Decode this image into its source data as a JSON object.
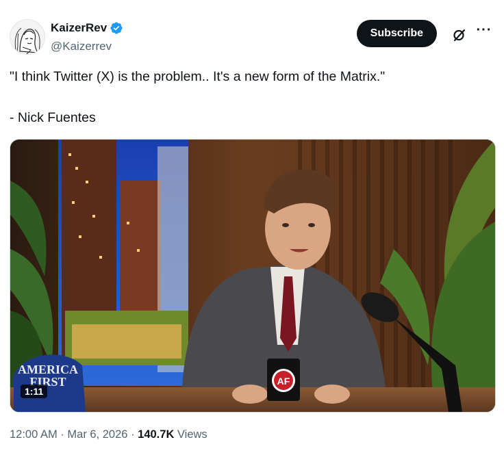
{
  "author": {
    "display_name": "KaizerRev",
    "handle": "@Kaizerrev",
    "verified": true,
    "avatar_icon": "sketch-portrait-avatar"
  },
  "actions": {
    "subscribe_label": "Subscribe",
    "grok_icon": "grok-icon",
    "more_icon": "more-options-icon",
    "more_glyph": "···"
  },
  "tweet": {
    "line1": "\"I think Twitter (X) is the problem.. It's a new form of the Matrix.\"",
    "line2": "- Nick Fuentes"
  },
  "media": {
    "type": "video",
    "duration": "1:11",
    "cap_text_line1": "AMERICA",
    "cap_text_line2": "FIRST",
    "mug_text": "AF"
  },
  "meta": {
    "time": "12:00 AM",
    "separator": "·",
    "date": "Mar 6, 2026",
    "views_count": "140.7K",
    "views_label": "Views"
  },
  "colors": {
    "verified_blue": "#1d9bf0",
    "text_primary": "#0f1419",
    "text_secondary": "#536471",
    "button_dark": "#0f1419"
  }
}
